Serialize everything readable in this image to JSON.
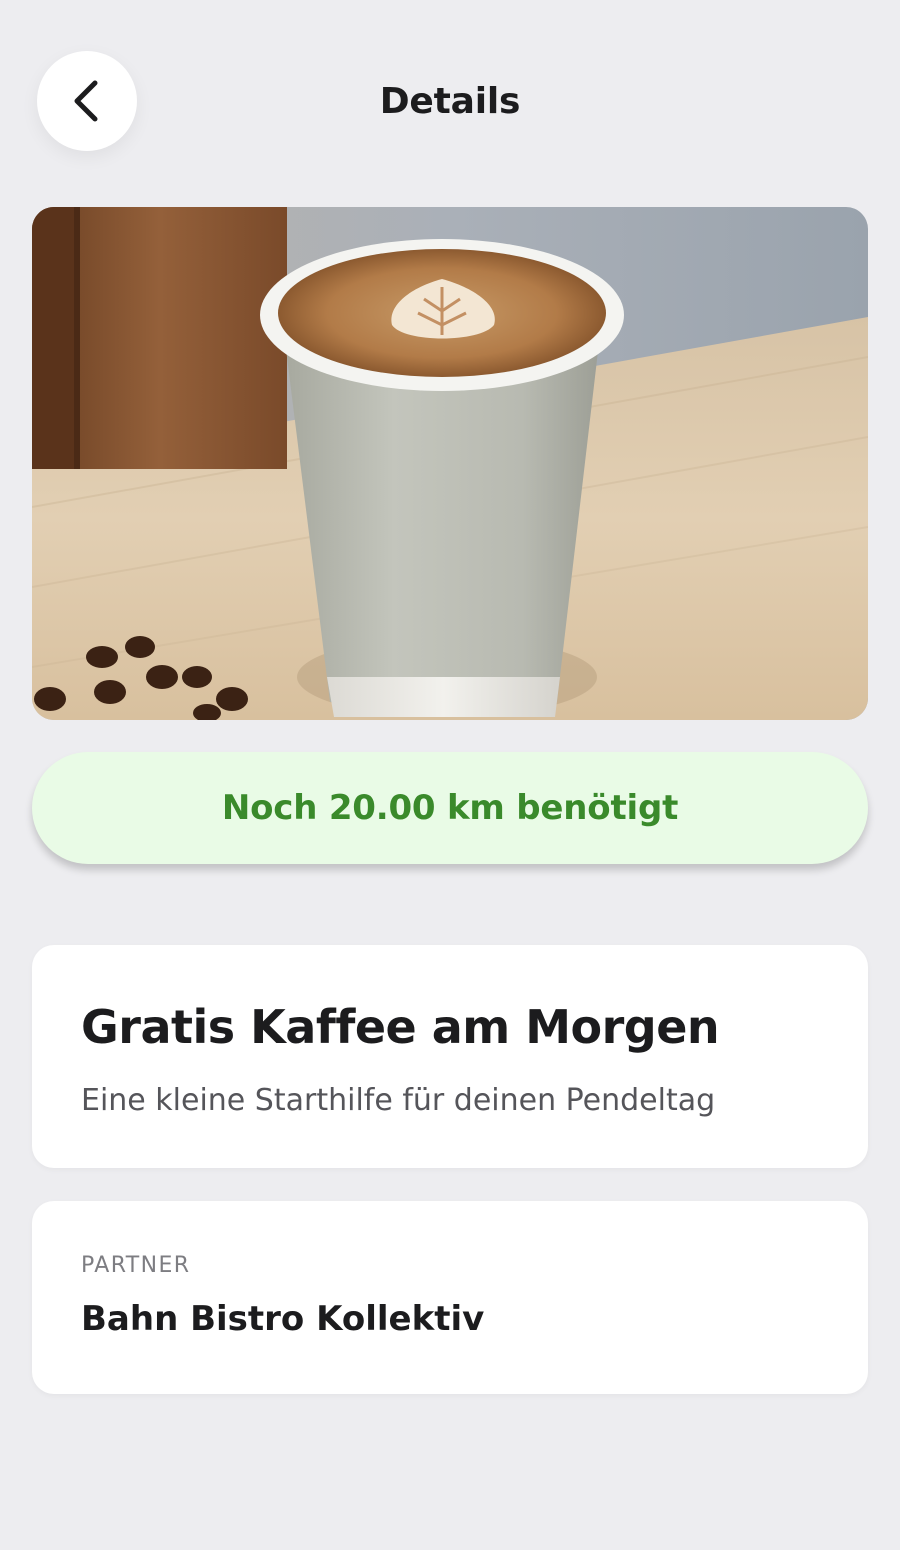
{
  "header": {
    "title": "Details",
    "back_icon": "chevron-left-icon"
  },
  "hero": {
    "image": "latte-paper-cup-photo"
  },
  "status": {
    "text": "Noch 20.00 km benötigt",
    "color": "#3a8a2b",
    "background": "#e9fbe6"
  },
  "offer": {
    "title": "Gratis Kaffee am Morgen",
    "subtitle": "Eine kleine Starthilfe für deinen Pendeltag"
  },
  "partner": {
    "label": "PARTNER",
    "name": "Bahn Bistro Kollektiv"
  }
}
